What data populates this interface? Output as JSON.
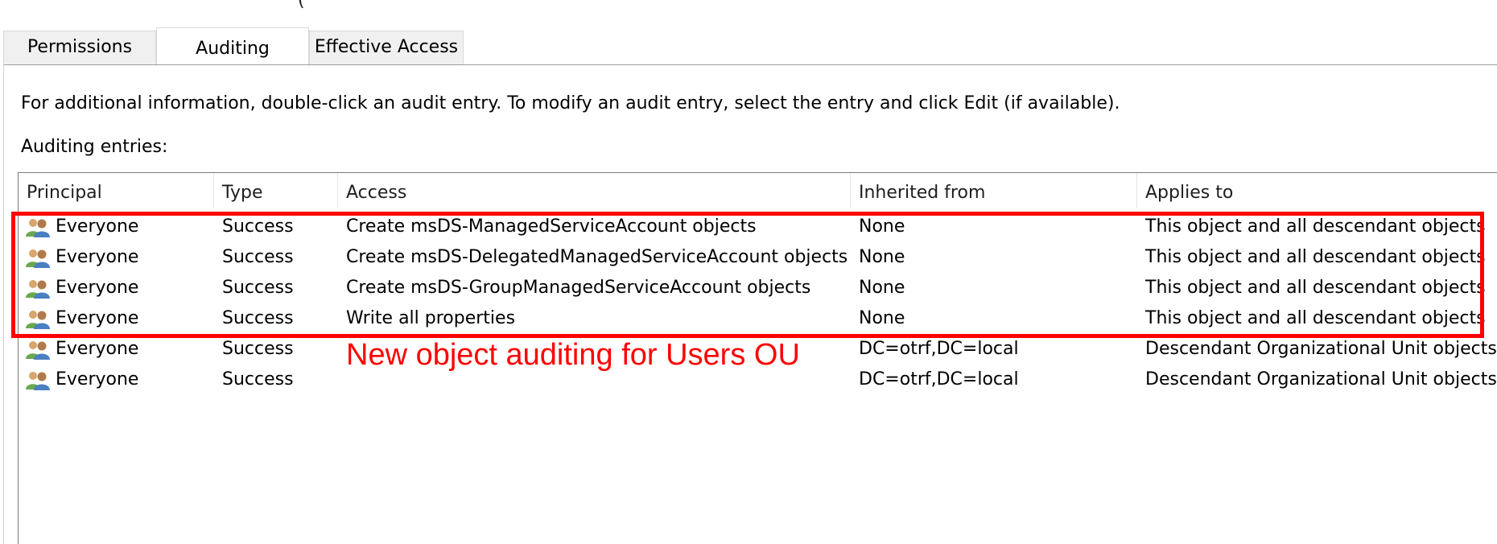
{
  "tabs": [
    {
      "label": "Permissions",
      "active": false
    },
    {
      "label": "Auditing",
      "active": true
    },
    {
      "label": "Effective Access",
      "active": false
    }
  ],
  "info_text": "For additional information, double-click an audit entry. To modify an audit entry, select the entry and click Edit (if available).",
  "entries_label": "Auditing entries:",
  "columns": [
    "Principal",
    "Type",
    "Access",
    "Inherited from",
    "Applies to"
  ],
  "rows": [
    {
      "principal": "Everyone",
      "type": "Success",
      "access": "Create msDS-ManagedServiceAccount objects",
      "inherited_from": "None",
      "applies_to": "This object and all descendant objects"
    },
    {
      "principal": "Everyone",
      "type": "Success",
      "access": "Create msDS-DelegatedManagedServiceAccount objects",
      "inherited_from": "None",
      "applies_to": "This object and all descendant objects"
    },
    {
      "principal": "Everyone",
      "type": "Success",
      "access": "Create msDS-GroupManagedServiceAccount objects",
      "inherited_from": "None",
      "applies_to": "This object and all descendant objects"
    },
    {
      "principal": "Everyone",
      "type": "Success",
      "access": "Write all properties",
      "inherited_from": "None",
      "applies_to": "This object and all descendant objects"
    },
    {
      "principal": "Everyone",
      "type": "Success",
      "access": "",
      "inherited_from": "DC=otrf,DC=local",
      "applies_to": "Descendant Organizational Unit objects"
    },
    {
      "principal": "Everyone",
      "type": "Success",
      "access": "",
      "inherited_from": "DC=otrf,DC=local",
      "applies_to": "Descendant Organizational Unit objects"
    }
  ],
  "annotation": "New object auditing for Users OU",
  "principal_icon": "users-group-icon",
  "colors": {
    "annotation": "#ff0000",
    "highlight_border": "#ff0000",
    "link": "#0066cc"
  }
}
